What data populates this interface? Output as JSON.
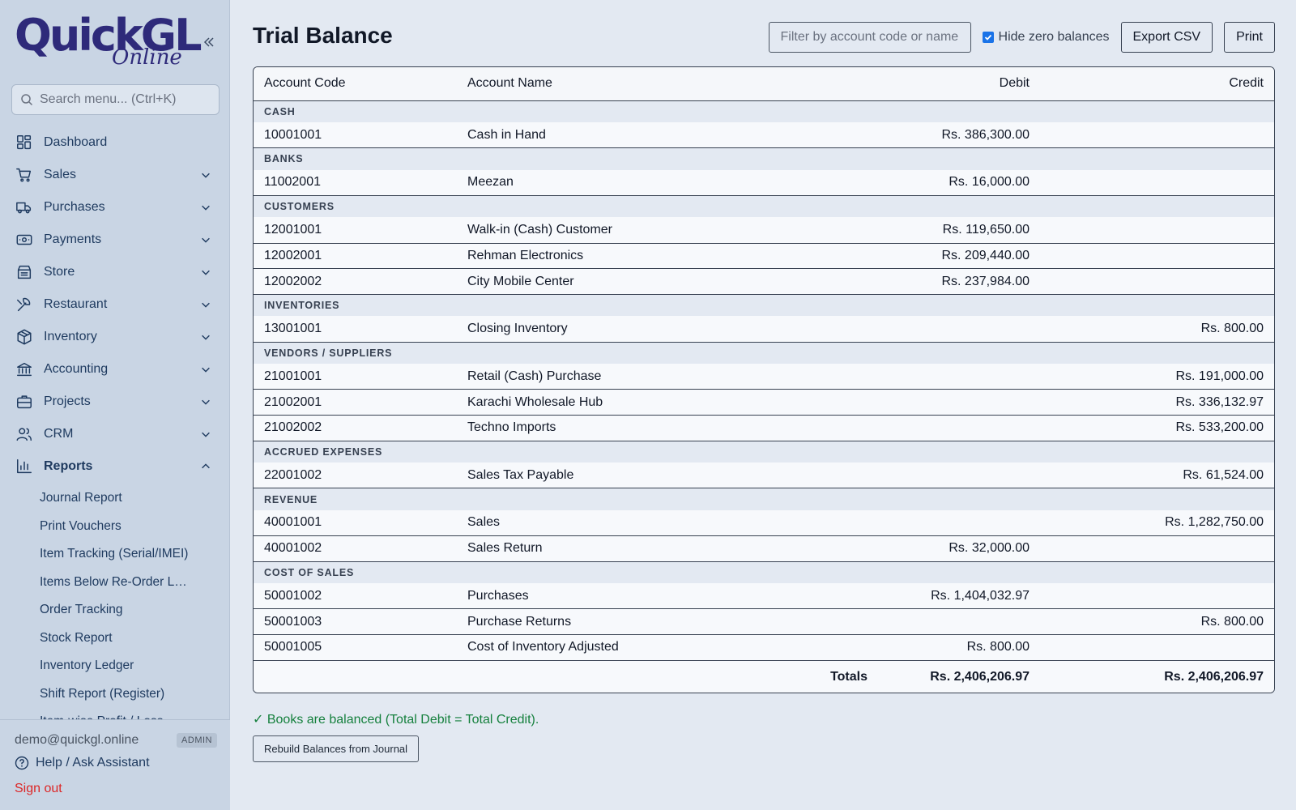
{
  "app": {
    "logo_main": "QuickGL",
    "logo_sub": "Online"
  },
  "sidebar": {
    "search_placeholder": "Search menu... (Ctrl+K)",
    "items": [
      {
        "label": "Dashboard",
        "icon": "dashboard-icon",
        "expandable": false
      },
      {
        "label": "Sales",
        "icon": "cart-icon",
        "expandable": true
      },
      {
        "label": "Purchases",
        "icon": "truck-icon",
        "expandable": true
      },
      {
        "label": "Payments",
        "icon": "banknote-icon",
        "expandable": true
      },
      {
        "label": "Store",
        "icon": "store-icon",
        "expandable": true
      },
      {
        "label": "Restaurant",
        "icon": "utensils-icon",
        "expandable": true
      },
      {
        "label": "Inventory",
        "icon": "package-icon",
        "expandable": true
      },
      {
        "label": "Accounting",
        "icon": "bank-icon",
        "expandable": true
      },
      {
        "label": "Projects",
        "icon": "briefcase-icon",
        "expandable": true
      },
      {
        "label": "CRM",
        "icon": "users-icon",
        "expandable": true
      },
      {
        "label": "Reports",
        "icon": "bar-chart-icon",
        "expandable": true,
        "expanded": true
      }
    ],
    "report_items": [
      "Journal Report",
      "Print Vouchers",
      "Item Tracking (Serial/IMEI)",
      "Items Below Re-Order Level",
      "Order Tracking",
      "Stock Report",
      "Inventory Ledger",
      "Shift Report (Register)",
      "Item-wise Profit / Loss"
    ],
    "footer": {
      "email": "demo@quickgl.online",
      "role": "ADMIN",
      "help": "Help / Ask Assistant",
      "signout": "Sign out"
    }
  },
  "main": {
    "title": "Trial Balance",
    "filter_placeholder": "Filter by account code or name...",
    "hide_zero_label": "Hide zero balances",
    "hide_zero_checked": true,
    "export_label": "Export CSV",
    "print_label": "Print",
    "columns": [
      "Account Code",
      "Account Name",
      "Debit",
      "Credit"
    ],
    "groups": [
      {
        "name": "CASH",
        "rows": [
          {
            "code": "10001001",
            "name": "Cash in Hand",
            "debit": "Rs. 386,300.00",
            "credit": ""
          }
        ]
      },
      {
        "name": "BANKS",
        "rows": [
          {
            "code": "11002001",
            "name": "Meezan",
            "debit": "Rs. 16,000.00",
            "credit": ""
          }
        ]
      },
      {
        "name": "CUSTOMERS",
        "rows": [
          {
            "code": "12001001",
            "name": "Walk-in (Cash) Customer",
            "debit": "Rs. 119,650.00",
            "credit": ""
          },
          {
            "code": "12002001",
            "name": "Rehman Electronics",
            "debit": "Rs. 209,440.00",
            "credit": ""
          },
          {
            "code": "12002002",
            "name": "City Mobile Center",
            "debit": "Rs. 237,984.00",
            "credit": ""
          }
        ]
      },
      {
        "name": "INVENTORIES",
        "rows": [
          {
            "code": "13001001",
            "name": "Closing Inventory",
            "debit": "",
            "credit": "Rs. 800.00"
          }
        ]
      },
      {
        "name": "VENDORS / SUPPLIERS",
        "rows": [
          {
            "code": "21001001",
            "name": "Retail (Cash) Purchase",
            "debit": "",
            "credit": "Rs. 191,000.00"
          },
          {
            "code": "21002001",
            "name": "Karachi Wholesale Hub",
            "debit": "",
            "credit": "Rs. 336,132.97"
          },
          {
            "code": "21002002",
            "name": "Techno Imports",
            "debit": "",
            "credit": "Rs. 533,200.00"
          }
        ]
      },
      {
        "name": "ACCRUED EXPENSES",
        "rows": [
          {
            "code": "22001002",
            "name": "Sales Tax Payable",
            "debit": "",
            "credit": "Rs. 61,524.00"
          }
        ]
      },
      {
        "name": "REVENUE",
        "rows": [
          {
            "code": "40001001",
            "name": "Sales",
            "debit": "",
            "credit": "Rs. 1,282,750.00"
          },
          {
            "code": "40001002",
            "name": "Sales Return",
            "debit": "Rs. 32,000.00",
            "credit": ""
          }
        ]
      },
      {
        "name": "COST OF SALES",
        "rows": [
          {
            "code": "50001002",
            "name": "Purchases",
            "debit": "Rs. 1,404,032.97",
            "credit": ""
          },
          {
            "code": "50001003",
            "name": "Purchase Returns",
            "debit": "",
            "credit": "Rs. 800.00"
          },
          {
            "code": "50001005",
            "name": "Cost of Inventory Adjusted",
            "debit": "Rs. 800.00",
            "credit": ""
          }
        ]
      }
    ],
    "totals": {
      "label": "Totals",
      "debit": "Rs. 2,406,206.97",
      "credit": "Rs. 2,406,206.97"
    },
    "balanced_message": "✓ Books are balanced (Total Debit = Total Credit).",
    "rebuild_label": "Rebuild Balances from Journal"
  },
  "colors": {
    "sidebar_bg": "#c9d5e4",
    "page_bg": "#e3e9f2",
    "success": "#15803d",
    "danger": "#dc2626",
    "accent": "#1a73e8"
  }
}
